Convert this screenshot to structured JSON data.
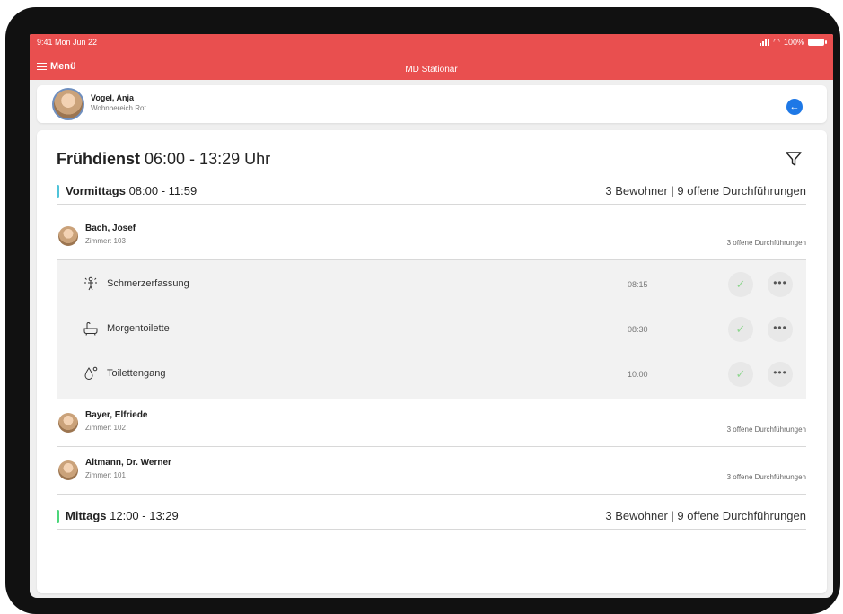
{
  "status_bar": {
    "time": "9:41  Mon Jun 22",
    "battery": "100%"
  },
  "app_bar": {
    "menu_label": "Menü",
    "title": "MD Stationär"
  },
  "user": {
    "name": "Vogel, Anja",
    "unit": "Wohnbereich Rot"
  },
  "shift": {
    "name": "Frühdienst",
    "time": "06:00 - 13:29 Uhr"
  },
  "sections": [
    {
      "name": "Vormittags",
      "time": "08:00 - 11:59",
      "stats": "3 Bewohner | 9 offene Durchführungen",
      "color": "#4fc3d9"
    },
    {
      "name": "Mittags",
      "time": "12:00 - 13:29",
      "stats": "3 Bewohner | 9 offene Durchführungen",
      "color": "#4cd67a"
    }
  ],
  "residents": [
    {
      "name": "Bach, Josef",
      "room": "Zimmer: 103",
      "open": "3 offene Durchführungen"
    },
    {
      "name": "Bayer, Elfriede",
      "room": "Zimmer: 102",
      "open": "3 offene Durchführungen"
    },
    {
      "name": "Altmann, Dr. Werner",
      "room": "Zimmer: 101",
      "open": "3 offene Durchführungen"
    }
  ],
  "tasks": [
    {
      "label": "Schmerzerfassung",
      "time": "08:15",
      "icon": "pain-assessment-icon"
    },
    {
      "label": "Morgentoilette",
      "time": "08:30",
      "icon": "bathtub-icon"
    },
    {
      "label": "Toilettengang",
      "time": "10:00",
      "icon": "drop-icon"
    }
  ],
  "colors": {
    "brand": "#e94f4f",
    "accent": "#1e78e6",
    "check": "#8ed68e"
  }
}
